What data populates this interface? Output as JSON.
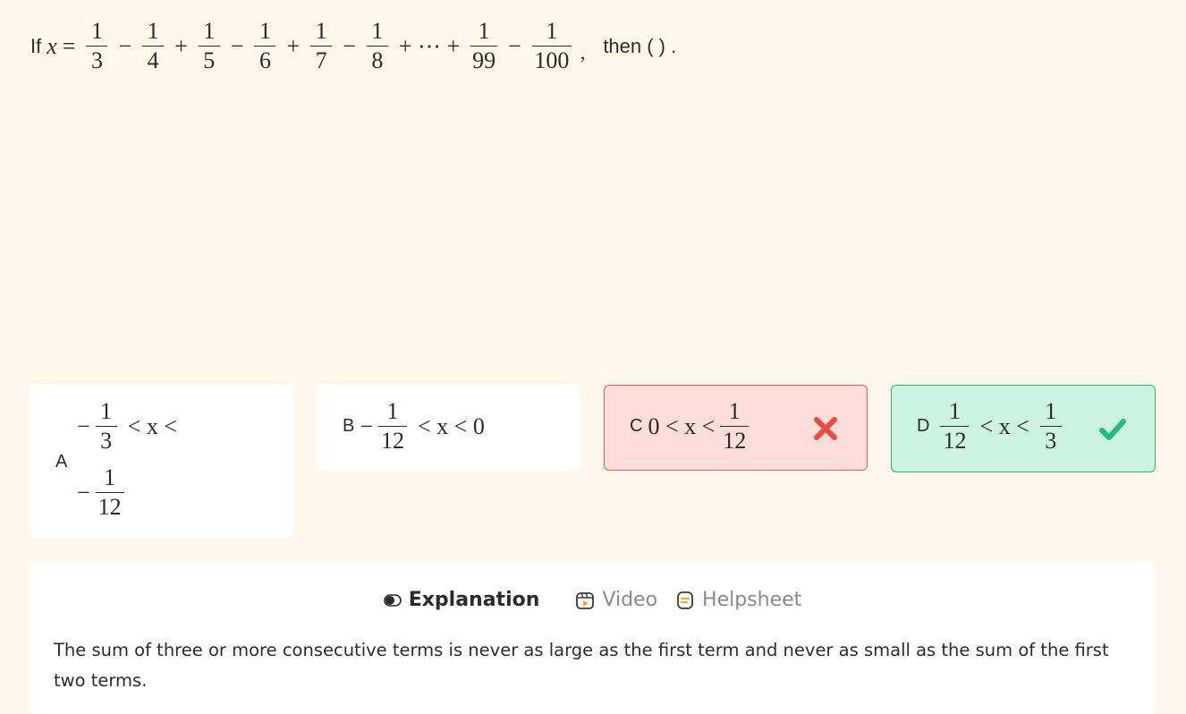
{
  "question": {
    "lead": "If",
    "var": "x",
    "equals": "=",
    "terms": [
      {
        "sign": "",
        "num": "1",
        "den": "3"
      },
      {
        "sign": "−",
        "num": "1",
        "den": "4"
      },
      {
        "sign": "+",
        "num": "1",
        "den": "5"
      },
      {
        "sign": "−",
        "num": "1",
        "den": "6"
      },
      {
        "sign": "+",
        "num": "1",
        "den": "7"
      },
      {
        "sign": "−",
        "num": "1",
        "den": "8"
      }
    ],
    "ellipsis": "+ ⋯ +",
    "tail": [
      {
        "sign": "",
        "num": "1",
        "den": "99"
      },
      {
        "sign": "−",
        "num": "1",
        "den": "100"
      }
    ],
    "comma": ",",
    "then": "then  (  ) ."
  },
  "options": {
    "a": {
      "letter": "A",
      "line1": {
        "minus": "−",
        "num": "1",
        "den": "3",
        "rel": "< x <"
      },
      "line2": {
        "minus": "−",
        "num": "1",
        "den": "12"
      }
    },
    "b": {
      "letter": "B",
      "minus": "−",
      "num": "1",
      "den": "12",
      "rel": "< x < 0"
    },
    "c": {
      "letter": "C",
      "lead": "0 < x <",
      "num": "1",
      "den": "12",
      "status": "wrong",
      "mark_icon": "cross-icon",
      "mark_color": "#f04a3e"
    },
    "d": {
      "letter": "D",
      "num1": "1",
      "den1": "12",
      "rel": "< x <",
      "num2": "1",
      "den2": "3",
      "status": "correct",
      "mark_icon": "check-icon",
      "mark_color": "#1fbf78"
    }
  },
  "explanation": {
    "tabs": [
      {
        "label": "Explanation",
        "icon": "toggle-dot-icon",
        "active": true
      },
      {
        "label": "Video",
        "icon": "video-icon",
        "active": false
      },
      {
        "label": "Helpsheet",
        "icon": "helpsheet-icon",
        "active": false
      }
    ],
    "text": "The sum of three or more consecutive terms is never as large as the first term and never as small as the sum of the first two terms."
  },
  "colors": {
    "page_bg": "#fff8ea",
    "wrong_bg": "#fddedb",
    "wrong_border": "#ef5b4e",
    "right_bg": "#cdf3e3",
    "right_border": "#26b77c"
  }
}
